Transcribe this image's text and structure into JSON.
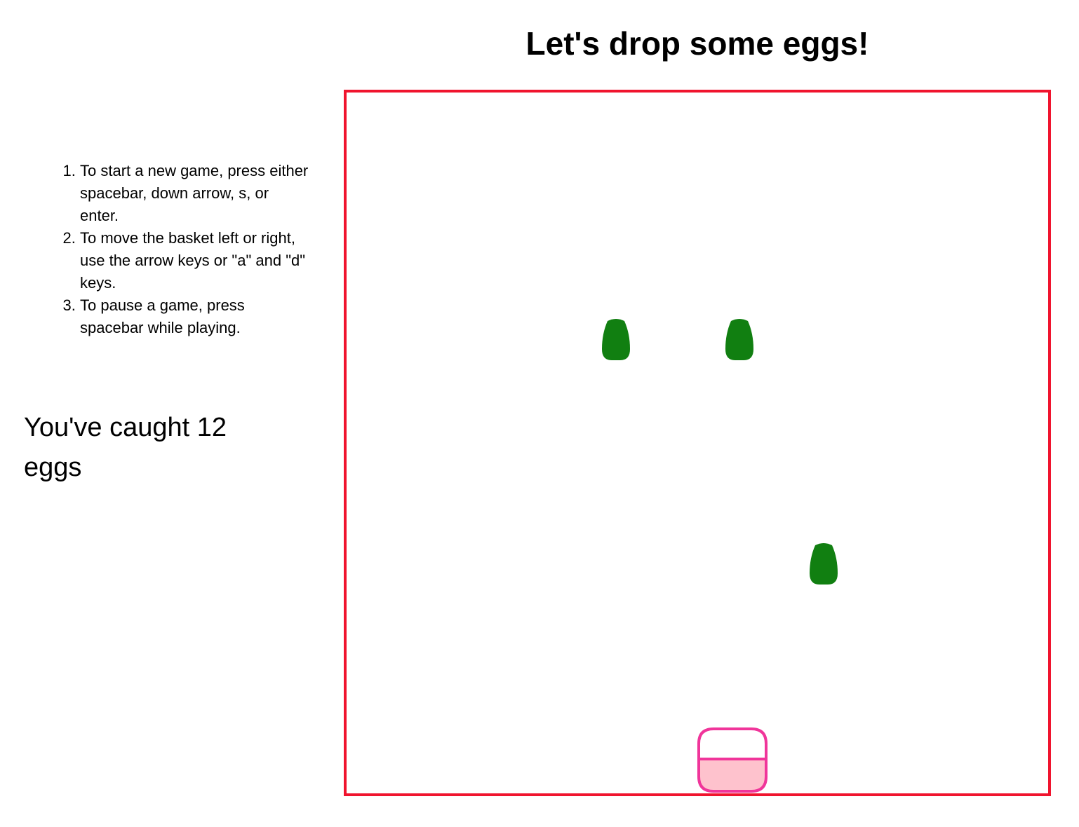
{
  "title": "Let's drop some eggs!",
  "instructions": [
    "To start a new game, press either spacebar, down arrow, s, or enter.",
    "To move the basket left or right, use the arrow keys or \"a\" and \"d\" keys.",
    "To pause a game, press spacebar while playing."
  ],
  "score": {
    "text": "You've caught 12 eggs",
    "count": 12
  },
  "game": {
    "border_color": "#f0142e",
    "egg_color": "#117f11",
    "basket_stroke_color": "#f0359a",
    "basket_fill_color": "#fec2cd",
    "eggs_visible": 3
  }
}
